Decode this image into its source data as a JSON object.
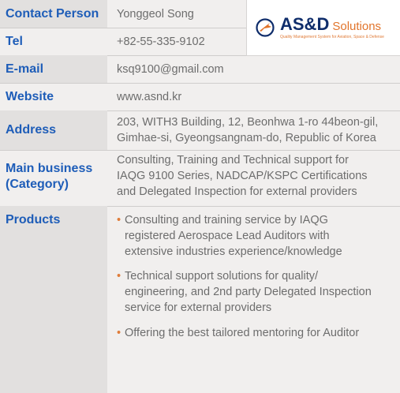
{
  "contact": {
    "label": "Contact Person",
    "value": "Yonggeol Song"
  },
  "tel": {
    "label": "Tel",
    "value": "+82-55-335-9102"
  },
  "email": {
    "label": "E-mail",
    "value": "ksq9100@gmail.com"
  },
  "website": {
    "label": "Website",
    "value": "www.asnd.kr"
  },
  "address": {
    "label": "Address",
    "lines": [
      "203, WITH3 Building, 12, Beonhwa 1-ro 44beon-gil,",
      "Gimhae-si, Gyeongsangnam-do, Republic of Korea"
    ]
  },
  "business": {
    "label_lines": [
      "Main business",
      "(Category)"
    ],
    "lines": [
      "Consulting, Training and Technical support for",
      "IAQG 9100 Series, NADCAP/KSPC Certifications",
      "and Delegated Inspection for external providers"
    ]
  },
  "products": {
    "label": "Products",
    "bullet_char": "•",
    "items": [
      [
        "Consulting and training service by IAQG",
        "registered Aerospace Lead Auditors with",
        "extensive industries experience/knowledge"
      ],
      [
        "Technical support solutions for quality/",
        "engineering, and 2nd party Delegated Inspection",
        "service for external providers"
      ],
      [
        "Offering the best tailored mentoring for Auditor"
      ]
    ]
  },
  "logo": {
    "brand": "AS&D",
    "suffix": "Solutions",
    "tagline": "Quality Management System for Aviation, Space & Defense",
    "icon": "airplane-globe-icon"
  },
  "colors": {
    "label": "#1e5db8",
    "label_bg": "#e2e0df",
    "page_bg": "#f1efee",
    "logo_navy": "#0f2d6b",
    "logo_orange": "#e1742b"
  }
}
